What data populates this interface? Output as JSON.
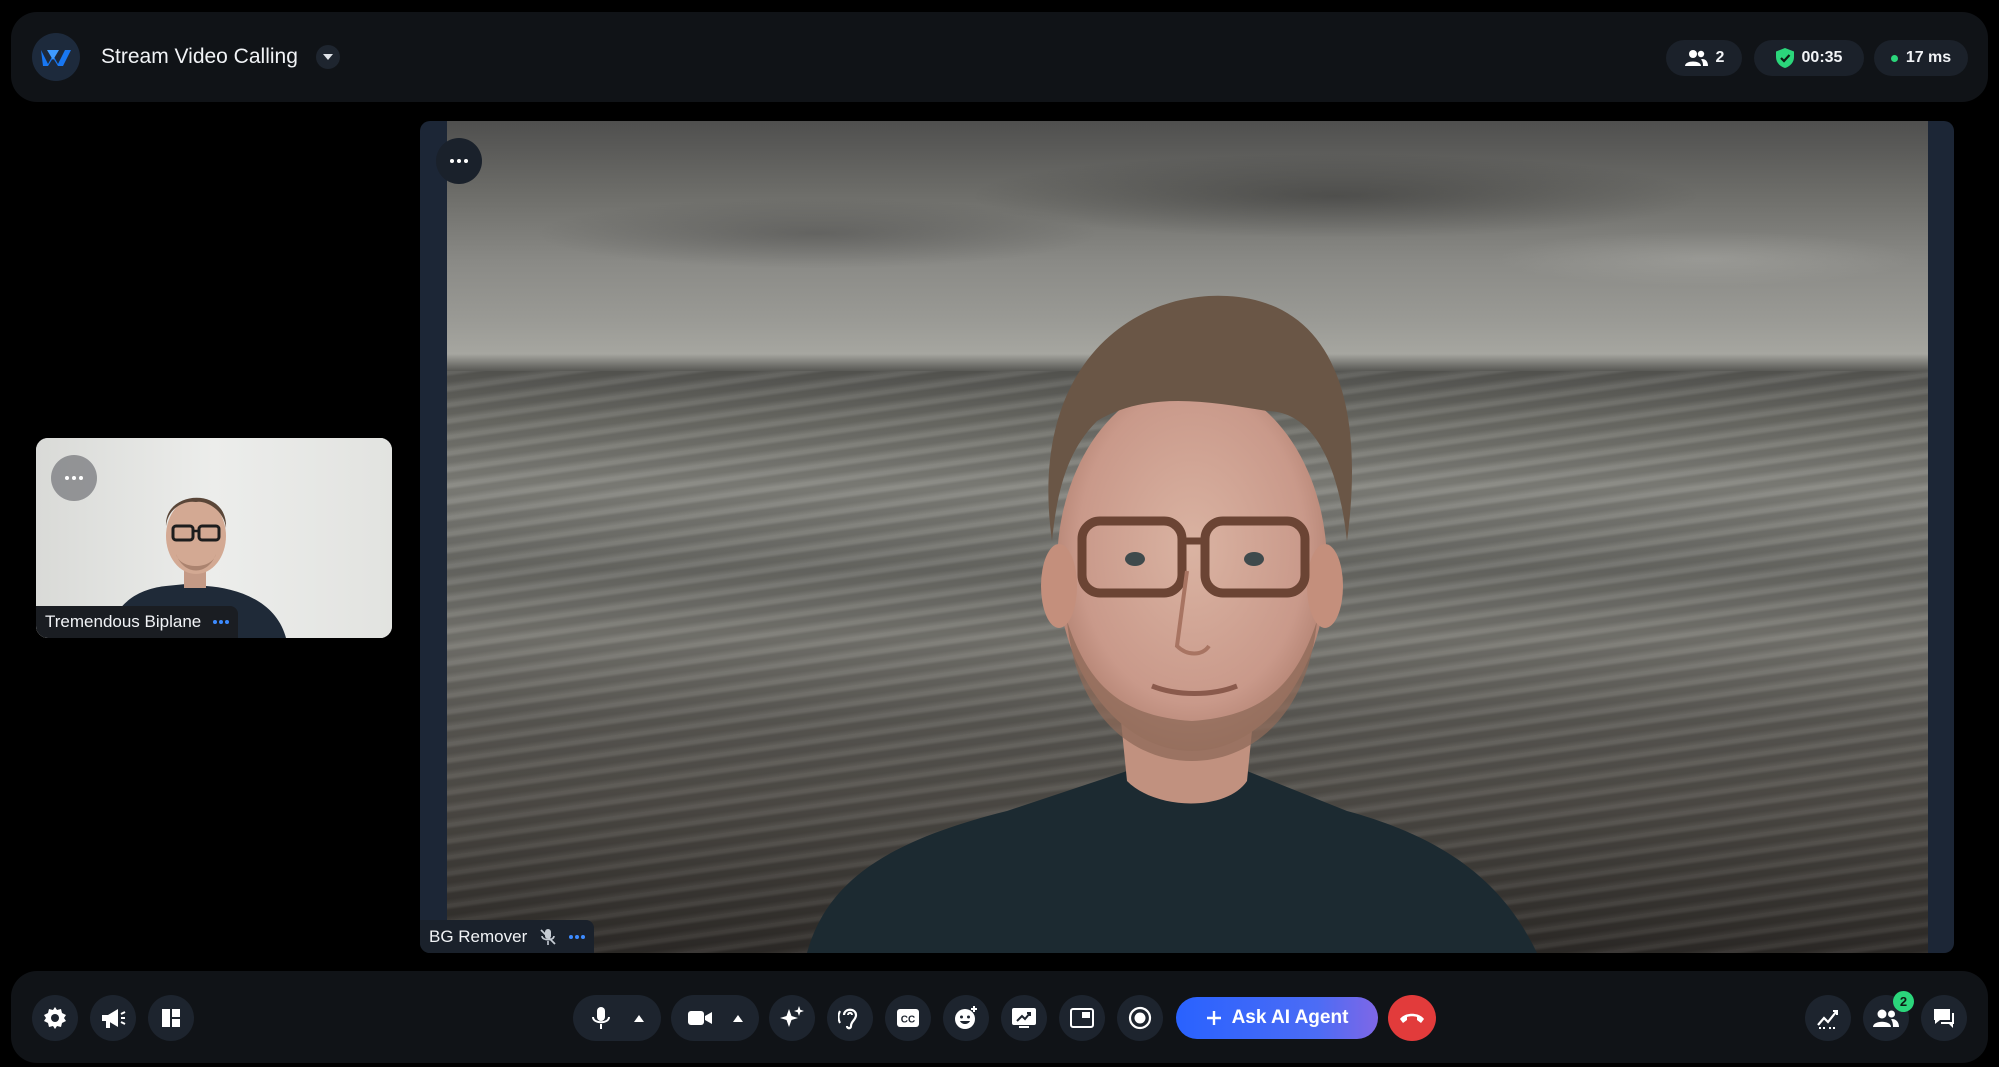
{
  "header": {
    "app_title": "Stream Video Calling",
    "participants_count": "2",
    "call_duration": "00:35",
    "latency": "17 ms",
    "latency_status_color": "#2bd67b"
  },
  "main_tile": {
    "participant_name": "BG Remover",
    "mic_state": "muted",
    "background": "ocean-virtual-background"
  },
  "thumbnail_tile": {
    "participant_name": "Tremendous Biplane"
  },
  "controls": {
    "left": [
      "gear-icon",
      "megaphone-icon",
      "layout-icon"
    ],
    "center": [
      "microphone-icon",
      "camera-icon",
      "sparkles-icon",
      "noise-cancel-icon",
      "closed-captions-icon",
      "reaction-icon",
      "screen-share-icon",
      "picture-in-picture-icon",
      "record-icon"
    ],
    "ask_ai_label": "Ask AI Agent",
    "right": [
      "stats-icon",
      "participants-icon",
      "chat-icon"
    ],
    "participants_badge": "2",
    "hangup_color": "#e23b3b",
    "accent_color": "#2962ff"
  }
}
